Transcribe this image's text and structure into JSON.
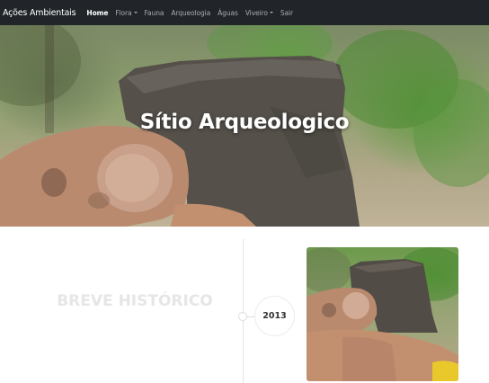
{
  "navbar": {
    "brand": "Ações Ambientais",
    "items": [
      {
        "label": "Home",
        "active": true,
        "dropdown": false
      },
      {
        "label": "Flora",
        "active": false,
        "dropdown": true
      },
      {
        "label": "Fauna",
        "active": false,
        "dropdown": false
      },
      {
        "label": "Arqueologia",
        "active": false,
        "dropdown": false
      },
      {
        "label": "Águas",
        "active": false,
        "dropdown": false
      },
      {
        "label": "Viveiro",
        "active": false,
        "dropdown": true
      },
      {
        "label": "Sair",
        "active": false,
        "dropdown": false
      }
    ]
  },
  "hero": {
    "title": "Sítio Arqueologico"
  },
  "timeline": {
    "section_title": "BREVE HISTÓRICO",
    "year": "2013"
  },
  "colors": {
    "navbar_bg": "#212529",
    "nav_active": "#ffffff",
    "nav_inactive": "rgba(255,255,255,0.6)",
    "section_title": "#e6e6e6"
  }
}
